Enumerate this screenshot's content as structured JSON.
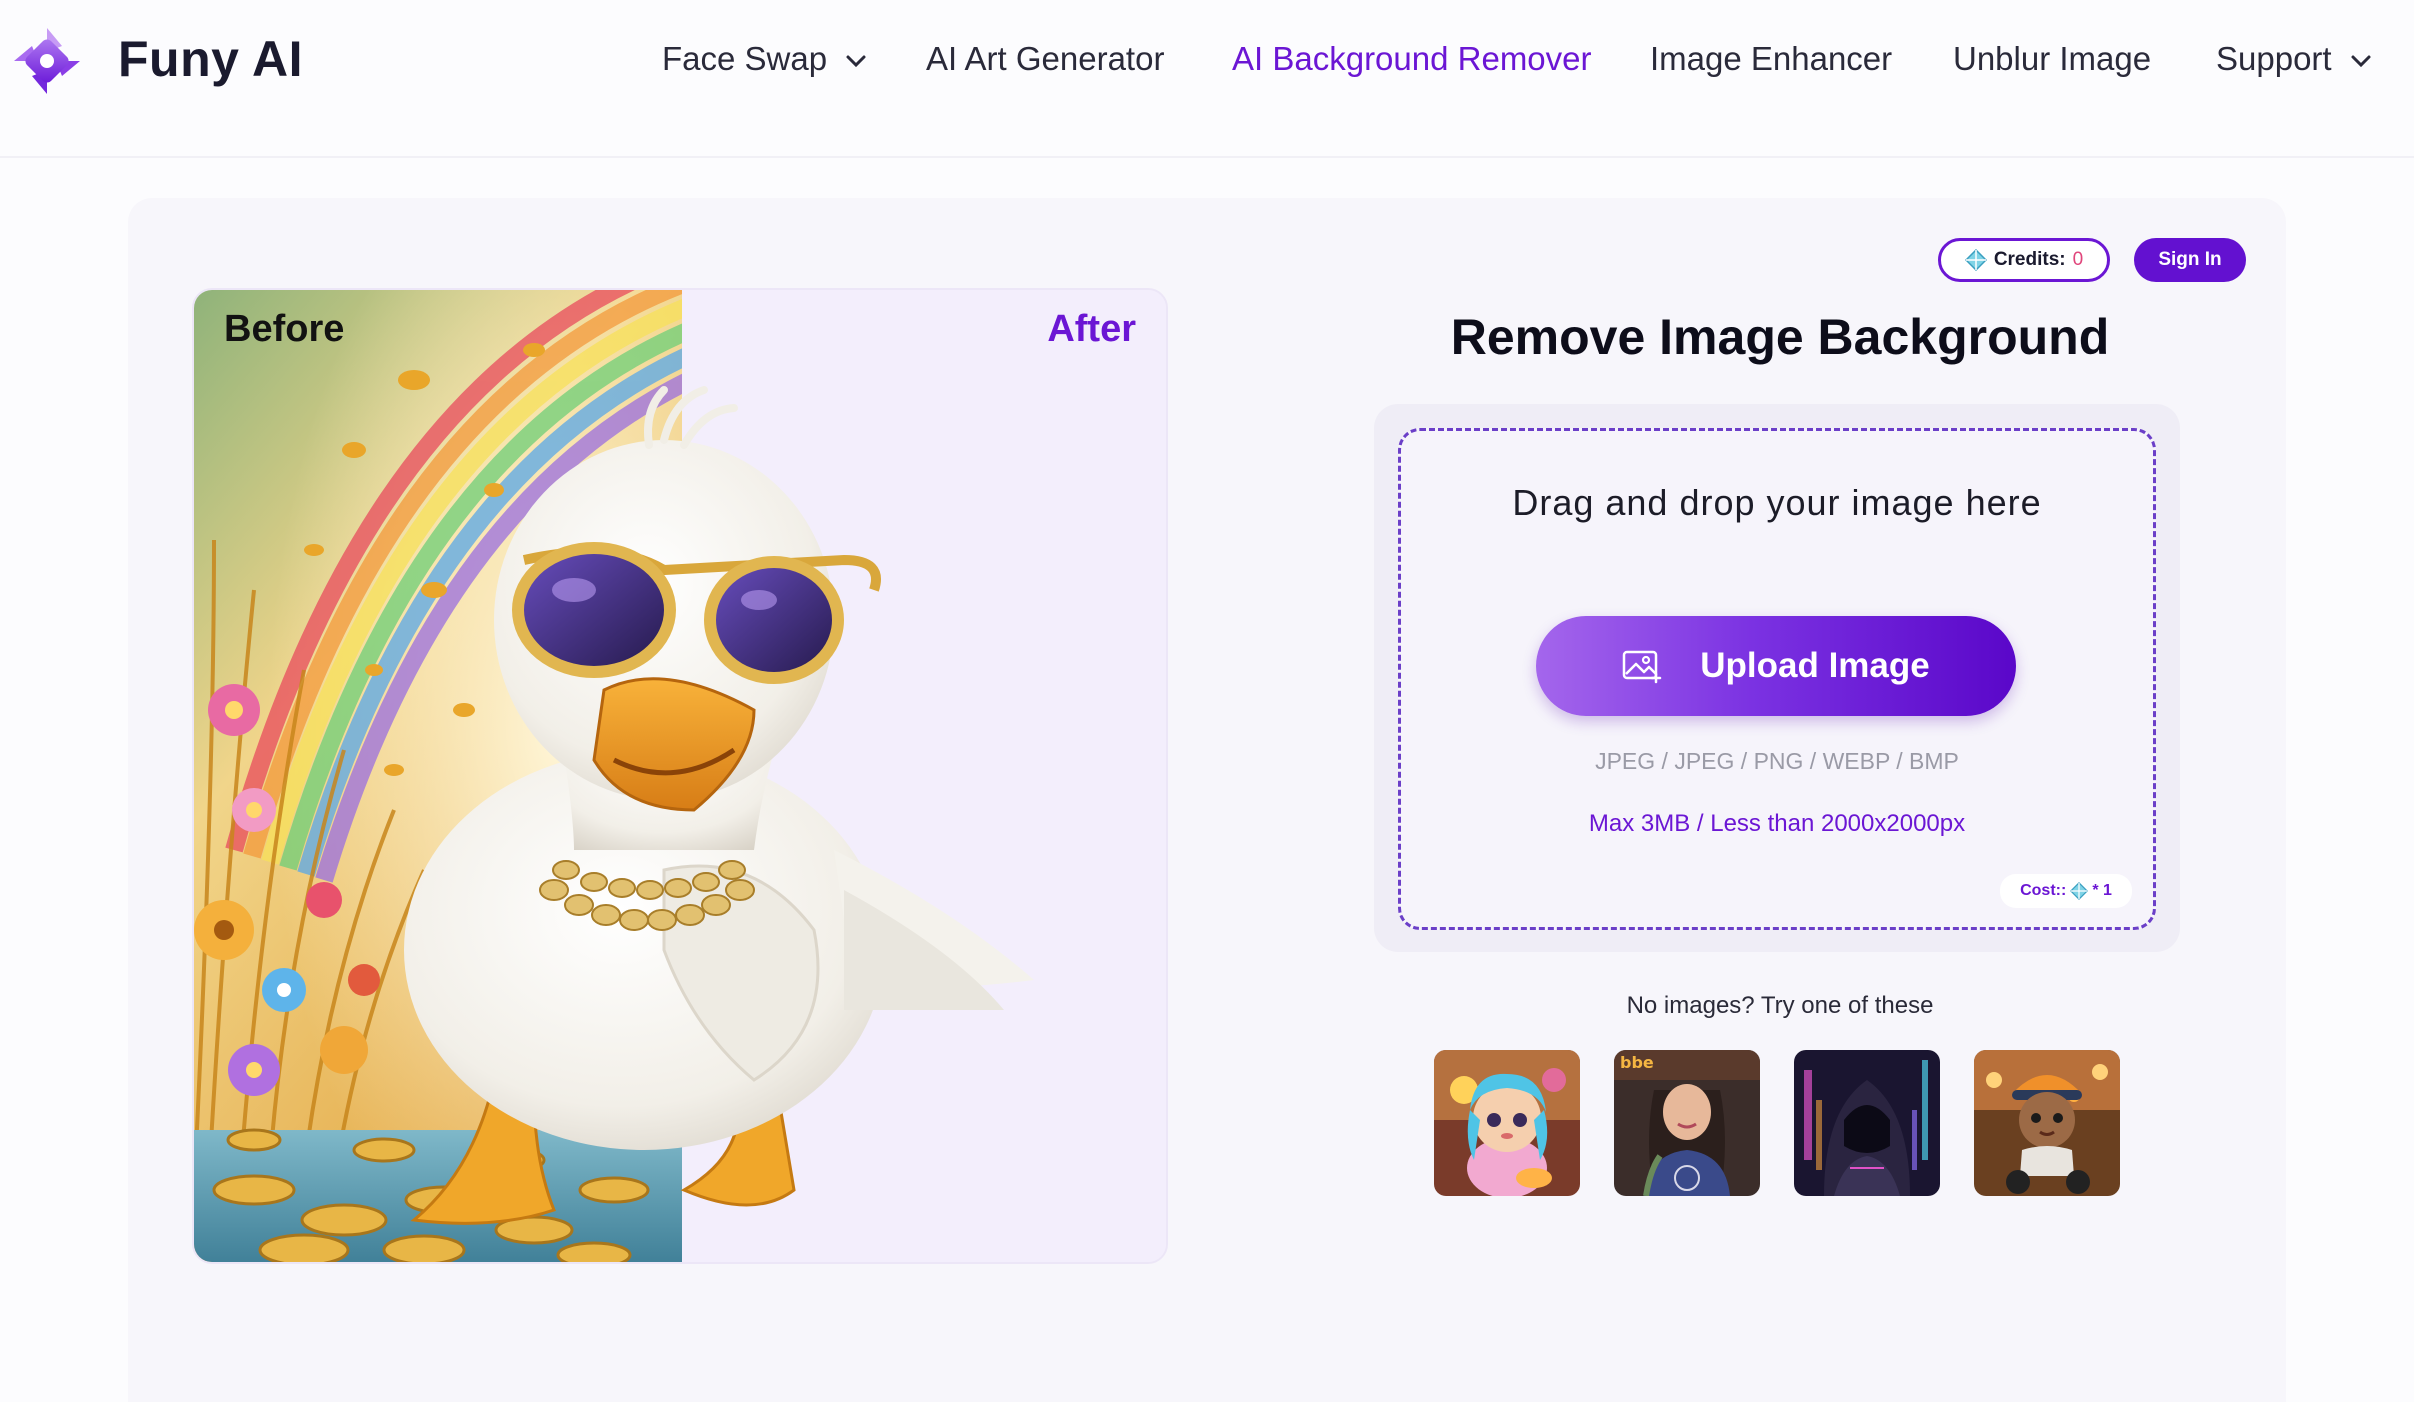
{
  "app": {
    "brand": "Funy AI",
    "accent_color": "#6b16d4",
    "logo_icon": "pinwheel-logo-icon"
  },
  "nav": {
    "items": [
      {
        "label": "Face Swap",
        "has_dropdown": true,
        "active": false
      },
      {
        "label": "AI Art Generator",
        "has_dropdown": false,
        "active": false
      },
      {
        "label": "AI Background Remover",
        "has_dropdown": false,
        "active": true
      },
      {
        "label": "Image Enhancer",
        "has_dropdown": false,
        "active": false
      },
      {
        "label": "Unblur Image",
        "has_dropdown": false,
        "active": false
      },
      {
        "label": "Support",
        "has_dropdown": true,
        "active": false
      }
    ]
  },
  "account": {
    "credits_label": "Credits:",
    "credits_value": "0",
    "credits_icon": "diamond-icon",
    "sign_in_label": "Sign In"
  },
  "preview": {
    "before_label": "Before",
    "after_label": "After"
  },
  "upload": {
    "title": "Remove Image Background",
    "drop_text": "Drag and drop your image here",
    "button_label": "Upload Image",
    "button_icon": "image-add-icon",
    "formats": "JPEG / JPEG / PNG / WEBP / BMP",
    "limits": "Max 3MB / Less than 2000x2000px",
    "cost_label": "Cost::",
    "cost_value": "* 1"
  },
  "samples": {
    "prompt": "No images? Try one of these",
    "items": [
      "sample-cartoon-girl",
      "sample-tattooed-woman",
      "sample-hooded-figure",
      "sample-boy-on-scooter"
    ]
  }
}
